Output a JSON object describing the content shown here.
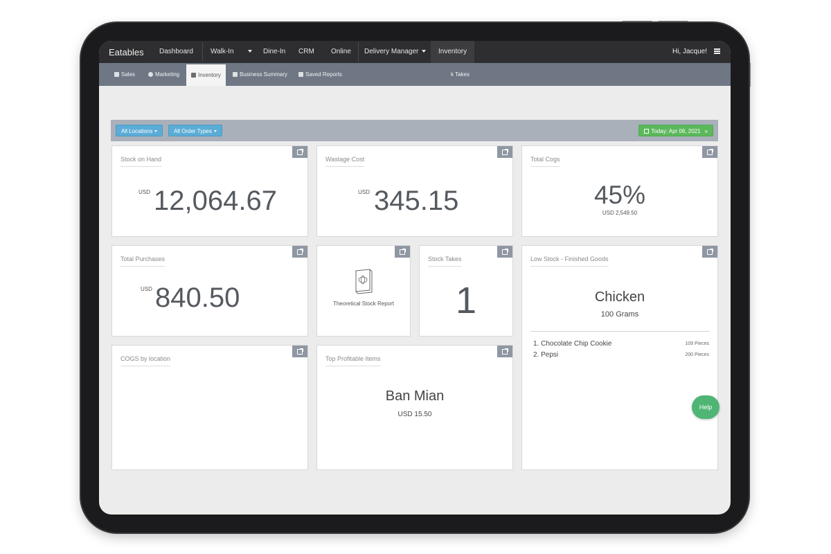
{
  "topbar": {
    "brand": "Eatables",
    "nav": [
      "Dashboard",
      "Walk-In",
      "Dine-In",
      "CRM",
      "Online",
      "Delivery Manager",
      "Inventory"
    ],
    "greeting": "Hi, Jacque!"
  },
  "subbar": {
    "items": [
      "Sales",
      "Marketing",
      "Inventory",
      "Business Summary",
      "Saved Reports"
    ],
    "extra": "k Takes"
  },
  "filters": {
    "locations": "All Locations",
    "order_types": "All Order Types",
    "date": "Today: Apr 06, 2021"
  },
  "cards": {
    "stock_on_hand": {
      "title": "Stock on Hand",
      "currency": "USD",
      "value": "12,064.67"
    },
    "wastage_cost": {
      "title": "Wastage Cost",
      "currency": "USD",
      "value": "345.15"
    },
    "total_cogs": {
      "title": "Total Cogs",
      "value": "45%",
      "sub": "USD 2,549.50"
    },
    "total_purchases": {
      "title": "Total Purchases",
      "currency": "USD",
      "value": "840.50"
    },
    "theoretical": {
      "label": "Theoretical Stock Report"
    },
    "stock_takes": {
      "title": "Stock Takes",
      "value": "1"
    },
    "low_stock": {
      "title": "Low Stock - Finished Goods",
      "item": "Chicken",
      "qty": "100 Grams",
      "list": [
        {
          "name": "1. Chocolate Chip Cookie",
          "qty": "109 Pieces"
        },
        {
          "name": "2. Pepsi",
          "qty": "200 Pieces"
        }
      ]
    },
    "cogs_by_location": {
      "title": "COGS by location"
    },
    "top_profitable": {
      "title": "Top Profitable Items",
      "item": "Ban Mian",
      "price": "USD 15.50"
    }
  },
  "help": "Help",
  "colors": {
    "topbar": "#2e2e30",
    "subbar": "#6f7784",
    "filter_button": "#5bacd6",
    "date_button": "#5cb85c",
    "help": "#4fb574"
  },
  "icons": [
    "scale-icon",
    "compass-icon",
    "box-icon",
    "tag-icon",
    "save-icon",
    "calendar-icon",
    "chevron-down-icon",
    "external-link-icon",
    "book-icon",
    "hamburger-icon"
  ]
}
